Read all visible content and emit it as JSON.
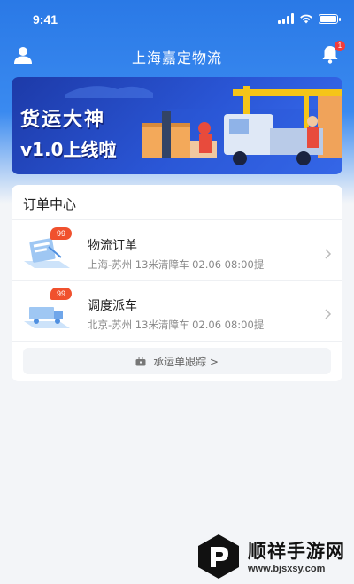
{
  "status_bar": {
    "time": "9:41",
    "icons": [
      "signal-icon",
      "wifi-icon",
      "battery-icon"
    ]
  },
  "nav": {
    "title": "上海嘉定物流",
    "notification_count": "1"
  },
  "banner": {
    "title": "货运大神",
    "subtitle": "v1.0上线啦"
  },
  "order_center": {
    "title": "订单中心",
    "items": [
      {
        "title": "物流订单",
        "badge": "99",
        "description": "上海-苏州  13米清障车  02.06 08:00提",
        "icon": "logistics-order-icon"
      },
      {
        "title": "调度派车",
        "badge": "99",
        "description": "北京-苏州  13米清障车  02.06 08:00提",
        "icon": "dispatch-truck-icon"
      }
    ],
    "track_button": "承运单跟踪 >"
  },
  "watermark": {
    "name": "顺祥手游网",
    "url": "www.bjsxsy.com"
  },
  "colors": {
    "primary": "#2a79e6",
    "banner": "#1d3aa8",
    "badge": "#f0512e",
    "notify": "#f23c3c"
  }
}
